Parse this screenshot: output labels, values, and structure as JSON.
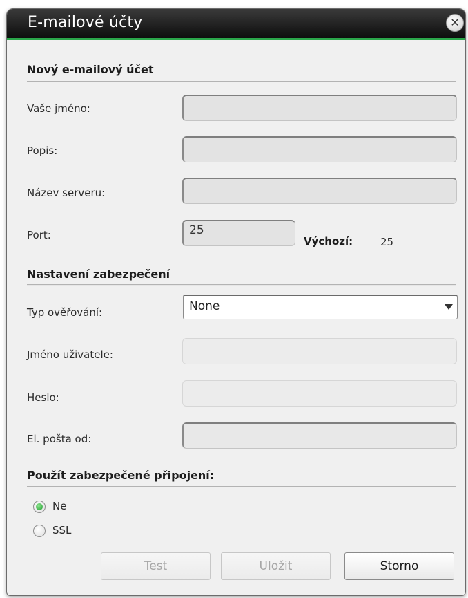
{
  "dialog": {
    "title": "E-mailové účty",
    "close_icon": "close-icon"
  },
  "account_section": {
    "heading": "Nový e-mailový účet",
    "name_label": "Vaše jméno:",
    "name_value": "",
    "description_label": "Popis:",
    "description_value": "",
    "server_label": "Název serveru:",
    "server_value": "",
    "port_label": "Port:",
    "port_value": "25",
    "default_label": "Výchozí:",
    "default_value": "25"
  },
  "security_section": {
    "heading": "Nastavení zabezpečení",
    "auth_type_label": "Typ ověřování:",
    "auth_type_value": "None",
    "username_label": "Jméno uživatele:",
    "password_label": "Heslo:",
    "from_label": "El. pošta od:",
    "from_value": ""
  },
  "secure_connection": {
    "heading": "Použít zabezpečené připojení:",
    "options": [
      {
        "label": "Ne",
        "checked": true
      },
      {
        "label": "SSL",
        "checked": false
      }
    ]
  },
  "buttons": {
    "test_label": "Test",
    "save_label": "Uložit",
    "cancel_label": "Storno"
  },
  "colors": {
    "accent": "#2aa64a",
    "titlebar": "#0d0d0d"
  }
}
